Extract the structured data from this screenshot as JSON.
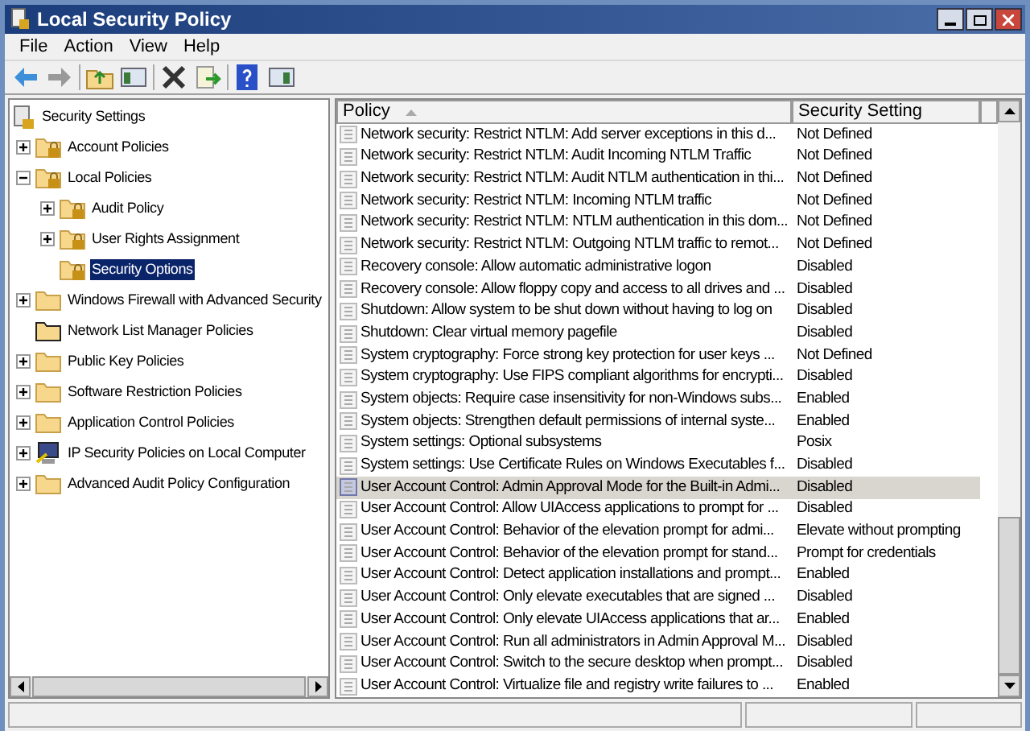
{
  "window": {
    "title": "Local Security Policy"
  },
  "menu": [
    "File",
    "Action",
    "View",
    "Help"
  ],
  "tree": [
    {
      "label": "Security Settings",
      "kind": "root",
      "selected": false,
      "children": [
        {
          "label": "Account Policies",
          "kind": "locked",
          "expandable": true,
          "expanded": false,
          "selected": false
        },
        {
          "label": "Local Policies",
          "kind": "locked",
          "expandable": true,
          "expanded": true,
          "selected": false,
          "children": [
            {
              "label": "Audit Policy",
              "kind": "locked",
              "expandable": true,
              "expanded": false,
              "selected": false
            },
            {
              "label": "User Rights Assignment",
              "kind": "locked",
              "expandable": true,
              "expanded": false,
              "selected": false
            },
            {
              "label": "Security Options",
              "kind": "locked",
              "expandable": false,
              "selected": true
            }
          ]
        },
        {
          "label": "Windows Firewall with Advanced Security",
          "kind": "folder",
          "expandable": true,
          "expanded": false,
          "selected": false
        },
        {
          "label": "Network List Manager Policies",
          "kind": "outlined",
          "expandable": false,
          "selected": false
        },
        {
          "label": "Public Key Policies",
          "kind": "folder",
          "expandable": true,
          "expanded": false,
          "selected": false
        },
        {
          "label": "Software Restriction Policies",
          "kind": "folder",
          "expandable": true,
          "expanded": false,
          "selected": false
        },
        {
          "label": "Application Control Policies",
          "kind": "folder",
          "expandable": true,
          "expanded": false,
          "selected": false
        },
        {
          "label": "IP Security Policies on Local Computer",
          "kind": "computer",
          "expandable": true,
          "expanded": false,
          "selected": false
        },
        {
          "label": "Advanced Audit Policy Configuration",
          "kind": "folder",
          "expandable": true,
          "expanded": false,
          "selected": false
        }
      ]
    }
  ],
  "table": {
    "columns": [
      {
        "label": "Policy",
        "sorted": true
      },
      {
        "label": "Security Setting",
        "sorted": false
      }
    ],
    "rows": [
      {
        "policy": "Network security: Restrict NTLM: Add server exceptions in this d...",
        "setting": "Not Defined",
        "selected": false
      },
      {
        "policy": "Network security: Restrict NTLM: Audit Incoming NTLM Traffic",
        "setting": "Not Defined",
        "selected": false
      },
      {
        "policy": "Network security: Restrict NTLM: Audit NTLM authentication in thi...",
        "setting": "Not Defined",
        "selected": false
      },
      {
        "policy": "Network security: Restrict NTLM: Incoming NTLM traffic",
        "setting": "Not Defined",
        "selected": false
      },
      {
        "policy": "Network security: Restrict NTLM: NTLM authentication in this dom...",
        "setting": "Not Defined",
        "selected": false
      },
      {
        "policy": "Network security: Restrict NTLM: Outgoing NTLM traffic to remot...",
        "setting": "Not Defined",
        "selected": false
      },
      {
        "policy": "Recovery console: Allow automatic administrative logon",
        "setting": "Disabled",
        "selected": false
      },
      {
        "policy": "Recovery console: Allow floppy copy and access to all drives and ...",
        "setting": "Disabled",
        "selected": false
      },
      {
        "policy": "Shutdown: Allow system to be shut down without having to log on",
        "setting": "Disabled",
        "selected": false
      },
      {
        "policy": "Shutdown: Clear virtual memory pagefile",
        "setting": "Disabled",
        "selected": false
      },
      {
        "policy": "System cryptography: Force strong key protection for user keys ...",
        "setting": "Not Defined",
        "selected": false
      },
      {
        "policy": "System cryptography: Use FIPS compliant algorithms for encrypti...",
        "setting": "Disabled",
        "selected": false
      },
      {
        "policy": "System objects: Require case insensitivity for non-Windows subs...",
        "setting": "Enabled",
        "selected": false
      },
      {
        "policy": "System objects: Strengthen default permissions of internal syste...",
        "setting": "Enabled",
        "selected": false
      },
      {
        "policy": "System settings: Optional subsystems",
        "setting": "Posix",
        "selected": false
      },
      {
        "policy": "System settings: Use Certificate Rules on Windows Executables f...",
        "setting": "Disabled",
        "selected": false
      },
      {
        "policy": "User Account Control: Admin Approval Mode for the Built-in Admi...",
        "setting": "Disabled",
        "selected": true
      },
      {
        "policy": "User Account Control: Allow UIAccess applications to prompt for ...",
        "setting": "Disabled",
        "selected": false
      },
      {
        "policy": "User Account Control: Behavior of the elevation prompt for admi...",
        "setting": "Elevate without prompting",
        "selected": false
      },
      {
        "policy": "User Account Control: Behavior of the elevation prompt for stand...",
        "setting": "Prompt for credentials",
        "selected": false
      },
      {
        "policy": "User Account Control: Detect application installations and prompt...",
        "setting": "Enabled",
        "selected": false
      },
      {
        "policy": "User Account Control: Only elevate executables that are signed ...",
        "setting": "Disabled",
        "selected": false
      },
      {
        "policy": "User Account Control: Only elevate UIAccess applications that ar...",
        "setting": "Enabled",
        "selected": false
      },
      {
        "policy": "User Account Control: Run all administrators in Admin Approval M...",
        "setting": "Disabled",
        "selected": false
      },
      {
        "policy": "User Account Control: Switch to the secure desktop when prompt...",
        "setting": "Disabled",
        "selected": false
      },
      {
        "policy": "User Account Control: Virtualize file and registry write failures to ...",
        "setting": "Enabled",
        "selected": false
      }
    ]
  }
}
